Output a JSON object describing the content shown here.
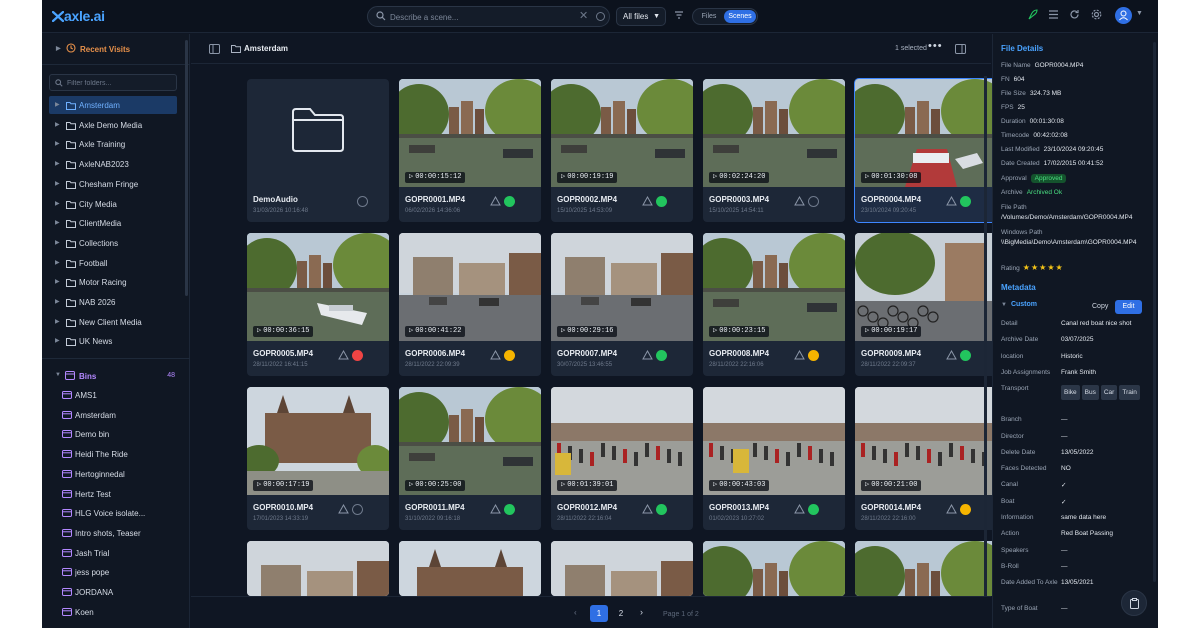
{
  "app": {
    "logo": "axle.ai"
  },
  "search": {
    "placeholder": "Describe a scene...",
    "scope": "All files",
    "mode_files": "Files",
    "mode_scenes": "Scenes"
  },
  "sidebar": {
    "recent_label": "Recent Visits",
    "filter_placeholder": "Filter folders...",
    "folders": [
      "Amsterdam",
      "Axle Demo Media",
      "Axle Training",
      "AxleNAB2023",
      "Chesham Fringe",
      "City Media",
      "ClientMedia",
      "Collections",
      "Football",
      "Motor Racing",
      "NAB 2026",
      "New Client Media",
      "UK News"
    ],
    "active_folder": "Amsterdam",
    "bins_label": "Bins",
    "bins_count": "48",
    "bins": [
      "AMS1",
      "Amsterdam",
      "Demo bin",
      "Heidi The Ride",
      "Hertoginnedal",
      "Hertz Test",
      "HLG Voice isolate...",
      "Intro shots, Teaser",
      "Jash Trial",
      "jess pope",
      "JORDANA",
      "Koen"
    ]
  },
  "main": {
    "breadcrumb": "Amsterdam",
    "selected": "1 selected",
    "folder_card": {
      "name": "DemoAudio",
      "date": "31/03/2026 10:16:48"
    },
    "cards": [
      {
        "name": "GOPR0001.MP4",
        "date": "06/02/2026 14:36:06",
        "tc": "00:00:15:12",
        "status": "green",
        "scene": "canal"
      },
      {
        "name": "GOPR0002.MP4",
        "date": "15/10/2025 14:53:09",
        "tc": "00:00:19:19",
        "status": "green",
        "scene": "canal2"
      },
      {
        "name": "GOPR0003.MP4",
        "date": "15/10/2025 14:54:11",
        "tc": "00:02:24:20",
        "status": "empty",
        "scene": "canal3"
      },
      {
        "name": "GOPR0004.MP4",
        "date": "23/10/2024 09:20:45",
        "tc": "00:01:30:08",
        "status": "green",
        "scene": "boat",
        "selected": true
      },
      {
        "name": "GOPR0005.MP4",
        "date": "28/11/2022 16:41:15",
        "tc": "00:00:36:15",
        "status": "red",
        "scene": "canal4"
      },
      {
        "name": "GOPR0006.MP4",
        "date": "28/11/2022 22:09:39",
        "tc": "00:00:41:22",
        "status": "yellow",
        "scene": "street"
      },
      {
        "name": "GOPR0007.MP4",
        "date": "30/07/2025 13:46:55",
        "tc": "00:00:29:16",
        "status": "green",
        "scene": "street2"
      },
      {
        "name": "GOPR0008.MP4",
        "date": "28/11/2022 22:16:06",
        "tc": "00:00:23:15",
        "status": "yellow",
        "scene": "canal5"
      },
      {
        "name": "GOPR0009.MP4",
        "date": "28/11/2022 22:09:37",
        "tc": "00:00:19:17",
        "status": "green",
        "scene": "bikes"
      },
      {
        "name": "GOPR0010.MP4",
        "date": "17/01/2023 14:33:19",
        "tc": "00:00:17:19",
        "status": "empty",
        "scene": "museum"
      },
      {
        "name": "GOPR0011.MP4",
        "date": "31/10/2022 09:16:18",
        "tc": "00:00:25:00",
        "status": "green",
        "scene": "canal6"
      },
      {
        "name": "GOPR0012.MP4",
        "date": "28/11/2022 22:16:04",
        "tc": "00:01:39:01",
        "status": "green",
        "scene": "square"
      },
      {
        "name": "GOPR0013.MP4",
        "date": "01/02/2023 10:27:02",
        "tc": "00:00:43:03",
        "status": "green",
        "scene": "square2"
      },
      {
        "name": "GOPR0014.MP4",
        "date": "28/11/2022 22:16:00",
        "tc": "00:00:21:00",
        "status": "yellow",
        "scene": "square3"
      }
    ],
    "pagination": {
      "pages": [
        "1",
        "2"
      ],
      "current": "1",
      "info": "Page 1 of 2"
    }
  },
  "details": {
    "title": "File Details",
    "file_name_label": "File Name",
    "file_name": "GOPR0004.MP4",
    "fn_label": "FN",
    "fn": "604",
    "size_label": "File Size",
    "size": "324.73 MB",
    "fps_label": "FPS",
    "fps": "25",
    "duration_label": "Duration",
    "duration": "00:01:30:08",
    "timecode_label": "Timecode",
    "timecode": "00:42:02:08",
    "modified_label": "Last Modified",
    "modified": "23/10/2024 09:20:45",
    "created_label": "Date Created",
    "created": "17/02/2015 00:41:52",
    "approval_label": "Approval",
    "approval": "Approved",
    "archive_label": "Archive",
    "archive": "Archived Ok",
    "path_label": "File Path",
    "path": "/Volumes/Demo/Amsterdam/GOPR0004.MP4",
    "winpath_label": "Windows Path",
    "winpath": "\\\\BigMedia\\Demo\\Amsterdam\\GOPR0004.MP4",
    "rating_label": "Rating",
    "rating": 5,
    "metadata_title": "Metadata",
    "custom_label": "Custom",
    "copy_label": "Copy",
    "edit_label": "Edit",
    "fields": [
      {
        "k": "Detail",
        "v": "Canal red boat nice shot"
      },
      {
        "k": "Archive Date",
        "v": "03/07/2025"
      },
      {
        "k": "location",
        "v": "Historic"
      },
      {
        "k": "Job Assignments",
        "v": "Frank Smith"
      },
      {
        "k": "Transport",
        "chips": [
          "Bike",
          "Bus",
          "Car",
          "Train"
        ]
      },
      {
        "k": "Branch",
        "v": "—"
      },
      {
        "k": "Director",
        "v": "—"
      },
      {
        "k": "Delete Date",
        "v": "13/05/2022"
      },
      {
        "k": "Faces Detected",
        "v": "NO"
      },
      {
        "k": "Canal",
        "v": "✓",
        "check": true
      },
      {
        "k": "Boat",
        "v": "✓",
        "check": true
      },
      {
        "k": "Information",
        "v": "same data here"
      },
      {
        "k": "Action",
        "v": "Red Boat Passing"
      },
      {
        "k": "Speakers",
        "v": "—"
      },
      {
        "k": "B-Roll",
        "v": "—"
      },
      {
        "k": "Date Added To Axle",
        "v": "13/05/2021"
      },
      {
        "k": "Type of Boat",
        "v": "—"
      }
    ]
  },
  "colors": {
    "accent": "#2f6fe4",
    "link": "#4aa3ff",
    "recent": "#e8914a",
    "bins": "#b388ff",
    "approved": "#4ade80"
  }
}
